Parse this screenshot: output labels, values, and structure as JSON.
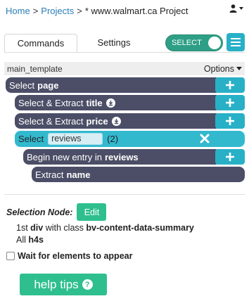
{
  "breadcrumb": {
    "home": "Home",
    "projects": "Projects",
    "separator": ">",
    "current": "* www.walmart.ca Project"
  },
  "tabs": [
    {
      "label": "Commands",
      "active": true
    },
    {
      "label": "Settings",
      "active": false
    }
  ],
  "select_toggle": {
    "label": "SELECT",
    "on": true
  },
  "template": {
    "name": "main_template",
    "options_label": "Options"
  },
  "commands": [
    {
      "prefix": "Select",
      "target": "page"
    },
    {
      "prefix": "Select & Extract",
      "target": "title"
    },
    {
      "prefix": "Select & Extract",
      "target": "price"
    },
    {
      "prefix": "Select",
      "field_value": "reviews",
      "count": "(2)"
    },
    {
      "prefix": "Begin new entry in",
      "target": "reviews"
    },
    {
      "prefix": "Extract",
      "target": "name"
    }
  ],
  "selection_node": {
    "label": "Selection Node:",
    "edit_label": "Edit",
    "line1_prefix": "1st",
    "line1_tag": "div",
    "line1_mid": "with class",
    "line1_class": "bv-content-data-summary",
    "line2_prefix": "All",
    "line2_tag": "h4s"
  },
  "wait_checkbox": {
    "label": "Wait for elements to appear",
    "checked": false
  },
  "help_button": {
    "label": "help tips"
  },
  "colors": {
    "command_bg": "#4b4e66",
    "accent": "#28b0c7",
    "active_select": "#33b9ce",
    "green": "#2fbf8f",
    "toggle_green": "#2e9f86",
    "link": "#2a7fb8"
  }
}
